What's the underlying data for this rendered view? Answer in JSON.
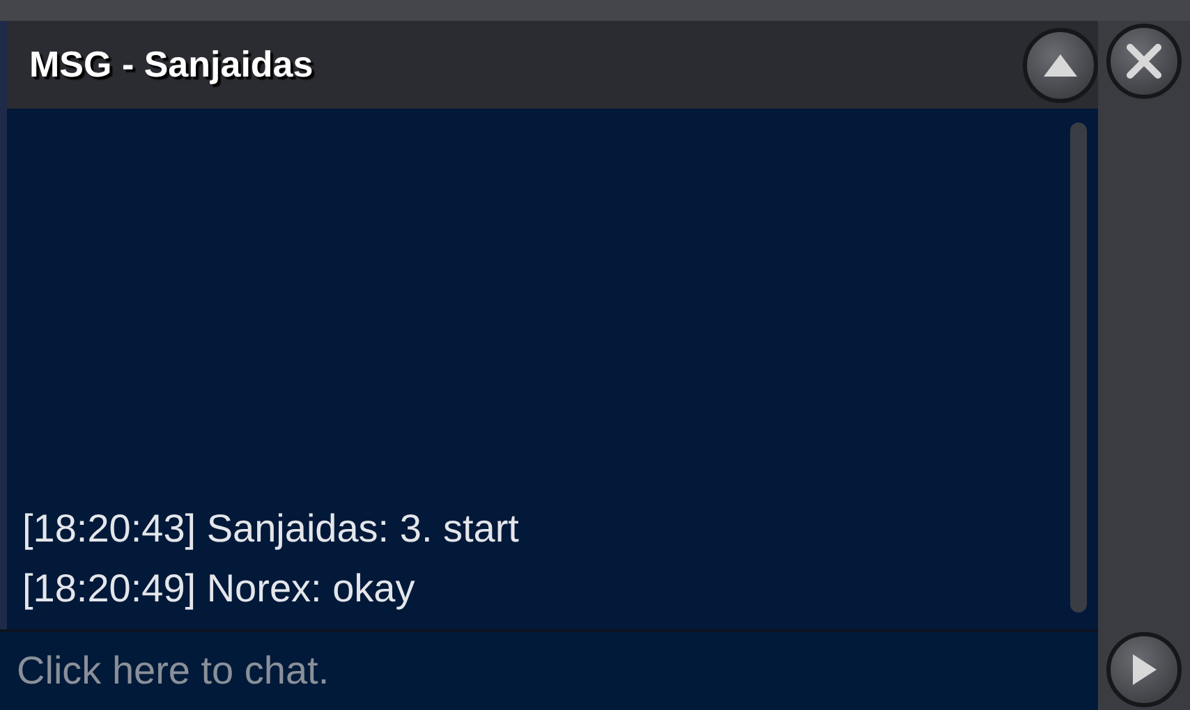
{
  "window": {
    "title": "MSG - Sanjaidas"
  },
  "messages": [
    {
      "text": "[18:20:43] Sanjaidas: 3. start"
    },
    {
      "text": "[18:20:49] Norex: okay"
    }
  ],
  "chat_input": {
    "placeholder": "Click here to chat."
  }
}
